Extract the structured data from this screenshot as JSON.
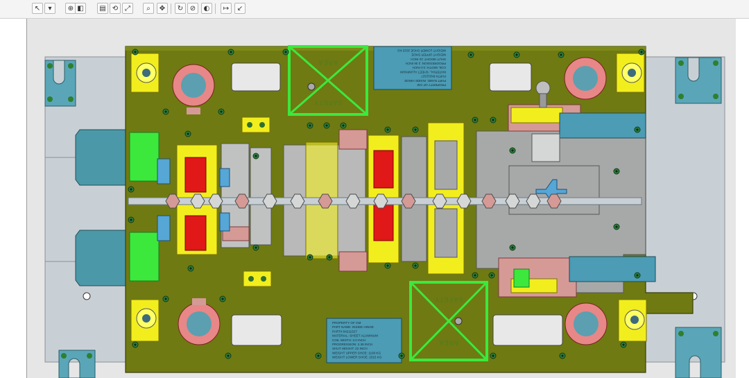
{
  "toolbar": {
    "buttons": [
      {
        "name": "select-icon",
        "glyph": "↖"
      },
      {
        "name": "filter-icon",
        "glyph": "▾"
      },
      {
        "name": "snap-icon",
        "glyph": "⊕"
      },
      {
        "name": "view-icon",
        "glyph": "◧"
      },
      {
        "name": "layers-icon",
        "glyph": "▤"
      },
      {
        "name": "orient-icon",
        "glyph": "⟲"
      },
      {
        "name": "fit-icon",
        "glyph": "⤢"
      },
      {
        "name": "zoom-icon",
        "glyph": "⌕"
      },
      {
        "name": "pan-icon",
        "glyph": "✥"
      },
      {
        "name": "rotate-icon",
        "glyph": "↻"
      },
      {
        "name": "section-icon",
        "glyph": "⊘"
      },
      {
        "name": "shade-icon",
        "glyph": "◐"
      },
      {
        "name": "measure-icon",
        "glyph": "↦"
      },
      {
        "name": "arrow-icon",
        "glyph": "↙"
      }
    ]
  },
  "model": {
    "stamps": {
      "top": [
        "SAFETY",
        "AREA"
      ],
      "bottom": [
        "SAFETY",
        "AREA"
      ]
    },
    "plate_top": [
      "PROPERTY OF GM",
      "PART NAME: INSIDE HINGE",
      "PART# 84211527",
      "MATERIAL: SHEET ALUMINUM",
      "COIL WIDTH: 3.0 INCH",
      "PROGRESSION: 2.36 INCH",
      "SHUT HEIGHT: 22 INCH",
      "WEIGHT UPPER SHOE",
      "WEIGHT LOWER SHOE 2015 KG"
    ],
    "plate_bottom": [
      "PROPERTY OF GM",
      "PART NAME: INSIDE HINGE",
      "PART# 84211527",
      "MATERIAL: SHEET ALUMINUM",
      "COIL WIDTH: 3.0 INCH",
      "PROGRESSION: 2.36 INCH",
      "SHUT HEIGHT: 22 INCH",
      "WEIGHT UPPER SHOE: 1100 KG",
      "WEIGHT LOWER SHOE: 2015 KG"
    ]
  },
  "colors": {
    "base_plate": "#6f7a12",
    "lower_shoe": "#c8cfd4",
    "clamp": "#4d9fb0",
    "yellow": "#f2ee1e",
    "green": "#35e035",
    "red": "#e01818",
    "pink": "#d59a96",
    "grey": "#a7a9a9",
    "blue": "#56a6d6"
  }
}
